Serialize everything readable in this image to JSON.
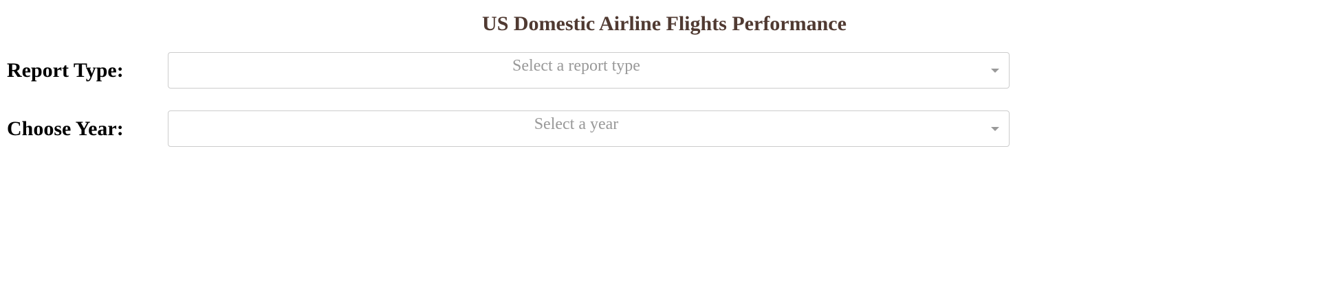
{
  "page": {
    "title": "US Domestic Airline Flights Performance"
  },
  "form": {
    "report_type": {
      "label": "Report Type:",
      "placeholder": "Select a report type",
      "icon": "chevron-down-icon"
    },
    "year": {
      "label": "Choose Year:",
      "placeholder": "Select a year",
      "icon": "chevron-down-icon"
    }
  },
  "colors": {
    "title": "#503A32",
    "label": "#000000",
    "placeholder": "#999999",
    "border": "#cccccc",
    "background": "#ffffff"
  }
}
